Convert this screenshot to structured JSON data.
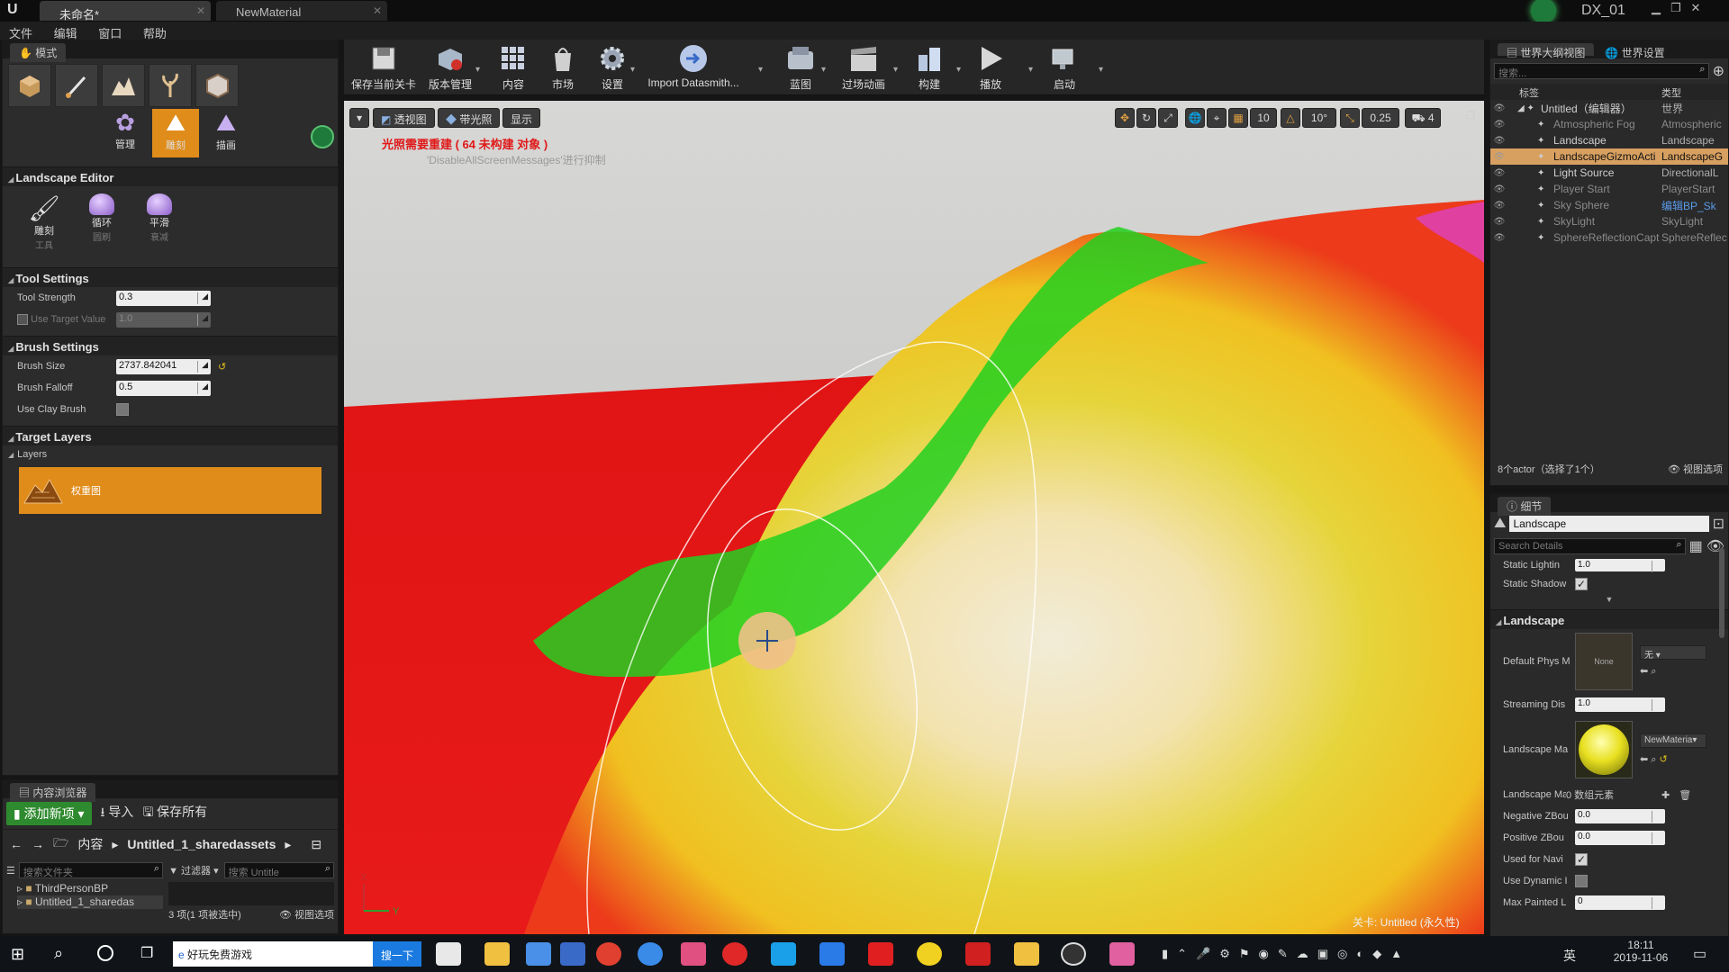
{
  "window": {
    "tabs": [
      {
        "label": "未命名*"
      },
      {
        "label": "NewMaterial"
      }
    ],
    "project_name": "DX_01"
  },
  "menu": {
    "items": [
      "文件",
      "编辑",
      "窗口",
      "帮助"
    ]
  },
  "modes_panel": {
    "tab_label": "模式",
    "subtools": [
      {
        "label": "管理"
      },
      {
        "label": "雕刻"
      },
      {
        "label": "描画"
      }
    ],
    "editor_title": "Landscape Editor",
    "brush_tools": [
      {
        "label": "雕刻",
        "sub": "工具"
      },
      {
        "label": "循环",
        "sub": "圆刷"
      },
      {
        "label": "平滑",
        "sub": "衰减"
      }
    ],
    "tool_settings": {
      "title": "Tool Settings",
      "tool_strength_label": "Tool Strength",
      "tool_strength": "0.3",
      "use_target_value_label": "Use Target Value",
      "use_target_value": "1.0"
    },
    "brush_settings": {
      "title": "Brush Settings",
      "brush_size_label": "Brush Size",
      "brush_size": "2737.842041",
      "brush_falloff_label": "Brush Falloff",
      "brush_falloff": "0.5",
      "use_clay_brush_label": "Use Clay Brush"
    },
    "target_layers": {
      "title": "Target Layers",
      "layers_label": "Layers",
      "heightmap_label": "权重图"
    }
  },
  "content_browser": {
    "tab_label": "内容浏览器",
    "add_new_label": "添加新项",
    "import_label": "导入",
    "save_all_label": "保存所有",
    "path_root": "内容",
    "path_folder": "Untitled_1_sharedassets",
    "search_folders_placeholder": "搜索文件夹",
    "filter_label": "过滤器",
    "search_assets_placeholder": "搜索 Untitle",
    "folders": [
      "ThirdPersonBP",
      "Untitled_1_sharedas"
    ],
    "status": "3 项(1 项被选中)",
    "view_options_label": "视图选项"
  },
  "toolbar": {
    "buttons": [
      {
        "label": "保存当前关卡"
      },
      {
        "label": "版本管理"
      },
      {
        "label": "内容"
      },
      {
        "label": "市场"
      },
      {
        "label": "设置"
      },
      {
        "label": "Import Datasmith..."
      },
      {
        "label": "蓝图"
      },
      {
        "label": "过场动画"
      },
      {
        "label": "构建"
      },
      {
        "label": "播放"
      },
      {
        "label": "启动"
      }
    ]
  },
  "viewport": {
    "perspective_label": "透视图",
    "lit_label": "带光照",
    "show_label": "显示",
    "warning_text": "光照需要重建 ( 64 未构建 对象 )",
    "warning_sub": "'DisableAllScreenMessages'进行抑制",
    "grid_snap": "10",
    "rotation_snap": "10°",
    "scale_snap": "0.25",
    "camera_speed": "4",
    "level_label": "关卡:  Untitled (永久性)",
    "axis_x_label": "X",
    "axis_y_label": "Y"
  },
  "outliner": {
    "tabs": [
      {
        "label": "世界大纲视图"
      },
      {
        "label": "世界设置"
      }
    ],
    "search_placeholder": "搜索...",
    "col_label": "标签",
    "col_type": "类型",
    "rows": [
      {
        "label": "Untitled（编辑器）",
        "type": "世界",
        "selected": false,
        "dim": false
      },
      {
        "label": "Atmospheric Fog",
        "type": "Atmospheric",
        "selected": false,
        "dim": true
      },
      {
        "label": "Landscape",
        "type": "Landscape",
        "selected": false,
        "dim": false
      },
      {
        "label": "LandscapeGizmoActi",
        "type": "LandscapeG",
        "selected": true,
        "dim": false
      },
      {
        "label": "Light Source",
        "type": "DirectionalL",
        "selected": false,
        "dim": false
      },
      {
        "label": "Player Start",
        "type": "PlayerStart",
        "selected": false,
        "dim": true
      },
      {
        "label": "Sky Sphere",
        "type": "编辑BP_Sk",
        "selected": false,
        "dim": true
      },
      {
        "label": "SkyLight",
        "type": "SkyLight",
        "selected": false,
        "dim": true
      },
      {
        "label": "SphereReflectionCapt",
        "type": "SphereReflec",
        "selected": false,
        "dim": true
      }
    ],
    "status": "8个actor（选择了1个）",
    "view_options_label": "视图选项"
  },
  "details": {
    "tab_label": "细节",
    "object_name": "Landscape",
    "search_placeholder": "Search Details",
    "static_lighting_label": "Static Lightin",
    "static_lighting_value": "1.0",
    "static_shadow_label": "Static Shadow",
    "section_title": "Landscape",
    "default_phys_label": "Default Phys M",
    "default_phys_thumb": "None",
    "default_phys_value": "无",
    "streaming_label": "Streaming Dis",
    "streaming_value": "1.0",
    "landscape_mat_label": "Landscape Ma",
    "landscape_mat_value": "NewMateria",
    "landscape_mat2_label": "Landscape Ma",
    "landscape_mat2_value": "0 数组元素",
    "neg_z_label": "Negative ZBou",
    "neg_z_value": "0.0",
    "pos_z_label": "Positive ZBou",
    "pos_z_value": "0.0",
    "used_nav_label": "Used for Navi",
    "use_dynamic_label": "Use Dynamic I",
    "max_painted_label": "Max Painted L",
    "max_painted_value": "0"
  },
  "taskbar": {
    "search_text": "好玩免费游戏",
    "search_button": "搜一下",
    "ime": "英",
    "time": "18:11",
    "date": "2019-11-06"
  }
}
